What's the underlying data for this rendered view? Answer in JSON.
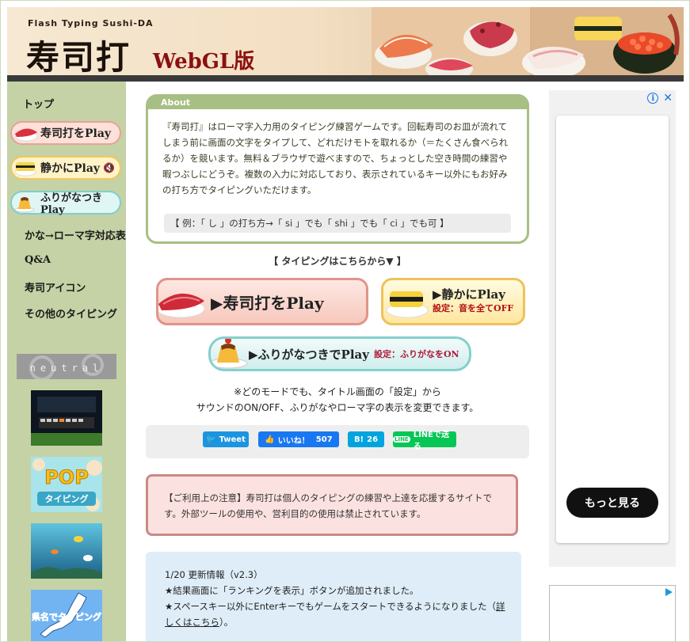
{
  "header": {
    "tagline": "Flash Typing Sushi-DA",
    "logo": "寿司打",
    "edition": "WebGL版"
  },
  "sidebar": {
    "top_link": "トップ",
    "play_buttons": [
      {
        "label": "寿司打をPlay",
        "icon": "maguro-sushi-icon"
      },
      {
        "label": "静かにPlay",
        "icon": "tamago-sushi-icon"
      },
      {
        "label": "ふりがなつきPlay",
        "icon": "pudding-icon"
      }
    ],
    "links": [
      "かな→ローマ字対応表",
      "Q&A",
      "寿司アイコン",
      "その他のタイピング"
    ],
    "banners": [
      {
        "name": "neutral",
        "label": "neutral"
      },
      {
        "name": "keyboard-game",
        "label": ""
      },
      {
        "name": "pop-typing",
        "label": "POP タイピング"
      },
      {
        "name": "aquarium",
        "label": ""
      },
      {
        "name": "kenmei-typing",
        "label": "県名でタイピング"
      }
    ]
  },
  "about": {
    "tab": "About",
    "body": "『寿司打』はローマ字入力用のタイピング練習ゲームです。回転寿司のお皿が流れてしまう前に画面の文字をタイプして、どれだけモトを取れるか（＝たくさん食べられるか）を競います。無料＆ブラウザで遊べますので、ちょっとした空き時間の練習や暇つぶしにどうぞ。複数の入力に対応しており、表示されているキー以外にもお好みの打ち方でタイピングいただけます。",
    "example": "【 例：「 し 」の打ち方→「 si 」でも「 shi 」でも「 ci 」でも可 】"
  },
  "play": {
    "heading": "【 タイピングはこちらから▼ 】",
    "main_label": "▶寿司打をPlay",
    "quiet_label": "▶静かにPlay",
    "quiet_sub": "設定：音を全てOFF",
    "furigana_label": "▶ふりがなつきでPlay",
    "furigana_sub": "設定：ふりがなをON"
  },
  "note": {
    "line1": "※どのモードでも、タイトル画面の「設定」から",
    "line2": "サウンドのON/OFF、ふりがなやローマ字の表示を変更できます。"
  },
  "share": {
    "tweet": "Tweet",
    "like": "いいね！",
    "like_count": "507",
    "hatena": "B!",
    "hatena_count": "26",
    "line": "LINEで送る",
    "colors": {
      "twitter": "#1b95e0",
      "facebook": "#1877f2",
      "hatena": "#00a4de",
      "line": "#06c755"
    }
  },
  "caution": {
    "text": "【ご利用上の注意】寿司打は個人のタイピングの練習や上達を応援するサイトです。外部ツールの使用や、営利目的の使用は禁止されています。"
  },
  "updates": {
    "date": "1/20 更新情報（v2.3）",
    "item1": "★結果画面に「ランキングを表示」ボタンが追加されました。",
    "item2_pre": "★スペースキー以外にEnterキーでもゲームをスタートできるようになりました（",
    "item2_link": "詳しくはこちら",
    "item2_post": "）。"
  },
  "ads": {
    "more": "もっと見る"
  }
}
